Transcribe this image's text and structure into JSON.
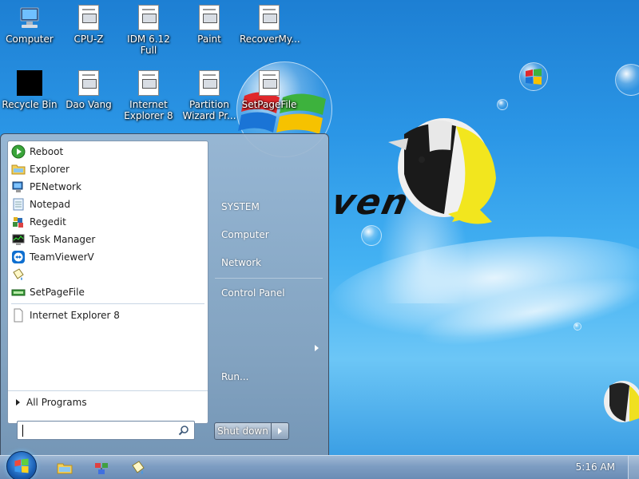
{
  "desktop": {
    "icons": [
      {
        "label": "Computer",
        "icon": "computer-icon"
      },
      {
        "label": "CPU-Z",
        "icon": "file-icon"
      },
      {
        "label": "IDM 6.12 Full",
        "icon": "file-icon"
      },
      {
        "label": "Paint",
        "icon": "file-icon"
      },
      {
        "label": "RecoverMy...",
        "icon": "file-icon"
      },
      {
        "label": "Recycle Bin",
        "icon": "recycle-bin-icon"
      },
      {
        "label": "Dao Vang",
        "icon": "file-icon"
      },
      {
        "label": "Internet Explorer 8",
        "icon": "file-icon"
      },
      {
        "label": "Partition Wizard Pr...",
        "icon": "file-icon"
      },
      {
        "label": "SetPageFile",
        "icon": "file-icon"
      }
    ],
    "wallpaper_text": "ven"
  },
  "start_menu": {
    "programs": [
      {
        "label": "Reboot",
        "icon": "reboot-icon"
      },
      {
        "label": "Explorer",
        "icon": "folder-icon"
      },
      {
        "label": "PENetwork",
        "icon": "network-icon"
      },
      {
        "label": "Notepad",
        "icon": "notepad-icon"
      },
      {
        "label": "Regedit",
        "icon": "regedit-icon"
      },
      {
        "label": "Task Manager",
        "icon": "task-manager-icon"
      },
      {
        "label": "TeamViewerV",
        "icon": "teamviewer-icon"
      },
      {
        "label": "",
        "icon": "paint-bucket-icon"
      },
      {
        "label": "SetPageFile",
        "icon": "setpagefile-icon"
      }
    ],
    "recent": [
      {
        "label": "Internet Explorer 8",
        "icon": "file-icon"
      }
    ],
    "all_programs": "All Programs",
    "search_placeholder": "",
    "right": {
      "system": "SYSTEM",
      "computer": "Computer",
      "network": "Network",
      "control_panel": "Control Panel",
      "run": "Run..."
    },
    "shutdown": "Shut down"
  },
  "taskbar": {
    "clock": "5:16 AM",
    "pinned": [
      "folder-icon",
      "network-icon",
      "paint-bucket-icon"
    ]
  },
  "colors": {
    "accent": "#1d7fd3",
    "taskbar": "#7d9dc2"
  }
}
